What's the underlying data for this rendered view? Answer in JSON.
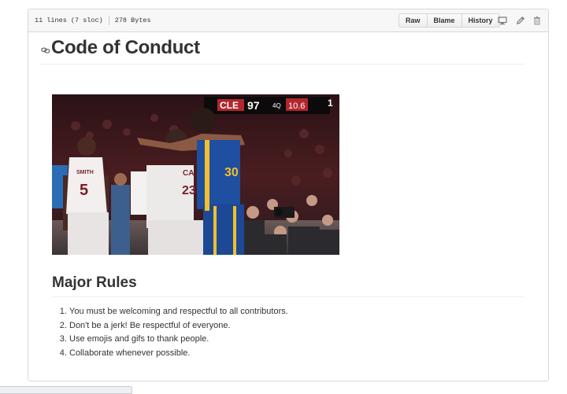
{
  "file_header": {
    "lines": "11 lines (7 sloc)",
    "size": "278 Bytes",
    "buttons": {
      "raw": "Raw",
      "blame": "Blame",
      "history": "History"
    },
    "icons": [
      "desktop-icon",
      "pencil-icon",
      "trash-icon"
    ]
  },
  "article": {
    "title": "Code of Conduct",
    "image": {
      "scoreboard_team": "CLE",
      "scoreboard_score": "97",
      "scoreboard_quarter": "4Q",
      "scoreboard_clock": "10.6",
      "jersey_name": "SMITH",
      "jersey_number": "5",
      "jersey_number_2": "23",
      "jersey_number_3": "30"
    },
    "section_heading": "Major Rules",
    "rules": [
      "You must be welcoming and respectful to all contributors.",
      "Don't be a jerk! Be respectful of everyone.",
      "Use emojis and gifs to thank people.",
      "Collaborate whenever possible."
    ]
  },
  "colors": {
    "header_bg": "#f7f7f7",
    "border": "#d8d8d8",
    "text": "#333333"
  }
}
